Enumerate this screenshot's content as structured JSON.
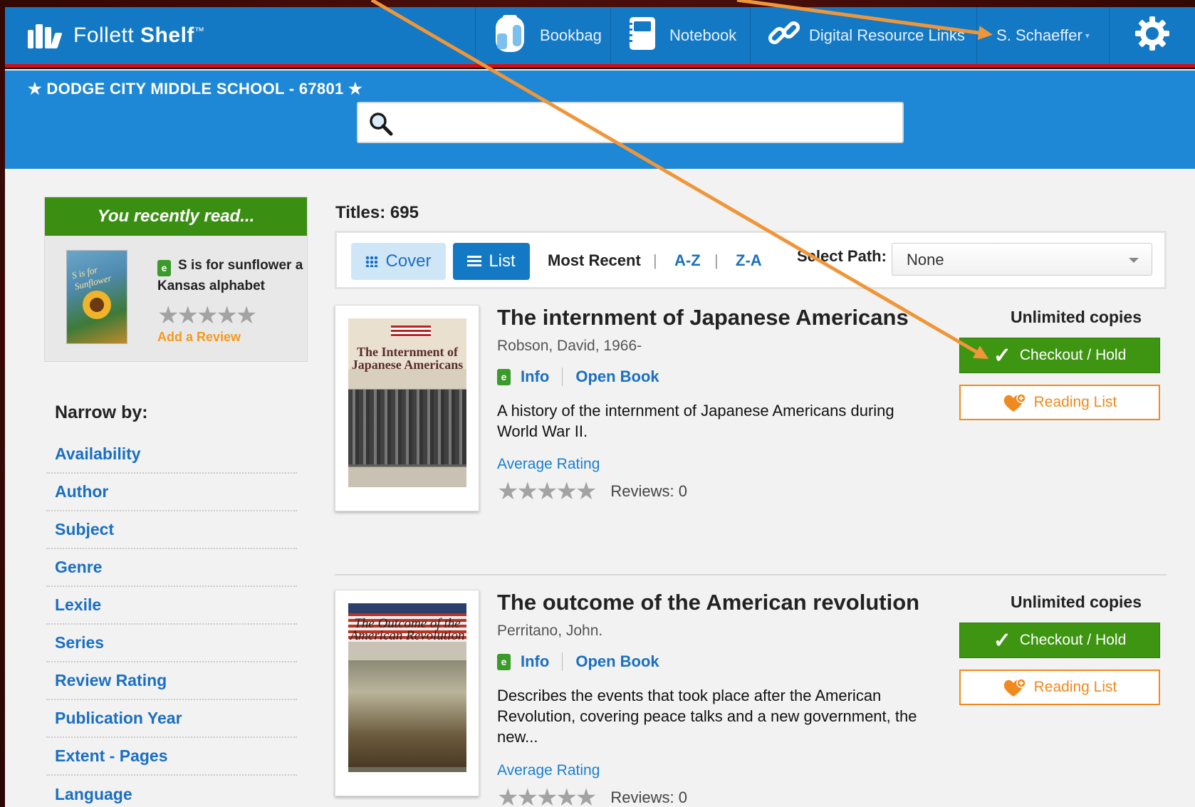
{
  "brand": {
    "name_light": "Follett",
    "name_bold": "Shelf",
    "tm": "™"
  },
  "nav": {
    "bookbag": "Bookbag",
    "notebook": "Notebook",
    "digital": "Digital Resource Links",
    "user": "S. Schaeffer"
  },
  "school": "★ DODGE CITY MIDDLE SCHOOL - 67801 ★",
  "search": {
    "placeholder": ""
  },
  "recent": {
    "heading": "You recently read...",
    "book_title": "S is for sunflower a Kansas alphabet",
    "add_review": "Add a Review",
    "cover_text": "S is for Sunflower"
  },
  "narrow": {
    "title": "Narrow by:",
    "facets": [
      "Availability",
      "Author",
      "Subject",
      "Genre",
      "Lexile",
      "Series",
      "Review Rating",
      "Publication Year",
      "Extent - Pages",
      "Language"
    ]
  },
  "results": {
    "titles_count": "Titles: 695",
    "view_cover": "Cover",
    "view_list": "List",
    "sort_recent": "Most Recent",
    "sort_az": "A-Z",
    "sort_za": "Z-A",
    "sep": "|",
    "path_label": "Select Path:",
    "path_value": "None"
  },
  "items": [
    {
      "title": "The internment of Japanese Americans",
      "author": "Robson, David, 1966-",
      "info": "Info",
      "open": "Open Book",
      "description": "A history of the internment of Japanese Americans during World War II.",
      "avg_rating": "Average Rating",
      "reviews": "Reviews: 0",
      "availability": "Unlimited copies",
      "checkout": "Checkout / Hold",
      "reading_list": "Reading List",
      "cover_text": "The Internment of Japanese Americans",
      "rating_stars": 0
    },
    {
      "title": "The outcome of the American revolution",
      "author": "Perritano, John.",
      "info": "Info",
      "open": "Open Book",
      "description": "Describes the events that took place after the American Revolution, covering peace talks and a new government, the new...",
      "avg_rating": "Average Rating",
      "reviews": "Reviews: 0",
      "availability": "Unlimited copies",
      "checkout": "Checkout / Hold",
      "reading_list": "Reading List",
      "cover_text": "The Outcome of the American Revolution",
      "rating_stars": 0
    }
  ],
  "colors": {
    "nav": "#1479c4",
    "banner": "#1e88d6",
    "green": "#3e9512",
    "orange": "#f08a1e",
    "link": "#1a6fc2",
    "annotation": "#f0963a"
  },
  "icons": [
    "follett-logo-icon",
    "bookbag-icon",
    "notebook-icon",
    "link-icon",
    "gear-icon",
    "search-icon",
    "grid-icon",
    "list-icon",
    "check-icon",
    "heart-plus-icon",
    "ebook-icon",
    "star-icon"
  ]
}
